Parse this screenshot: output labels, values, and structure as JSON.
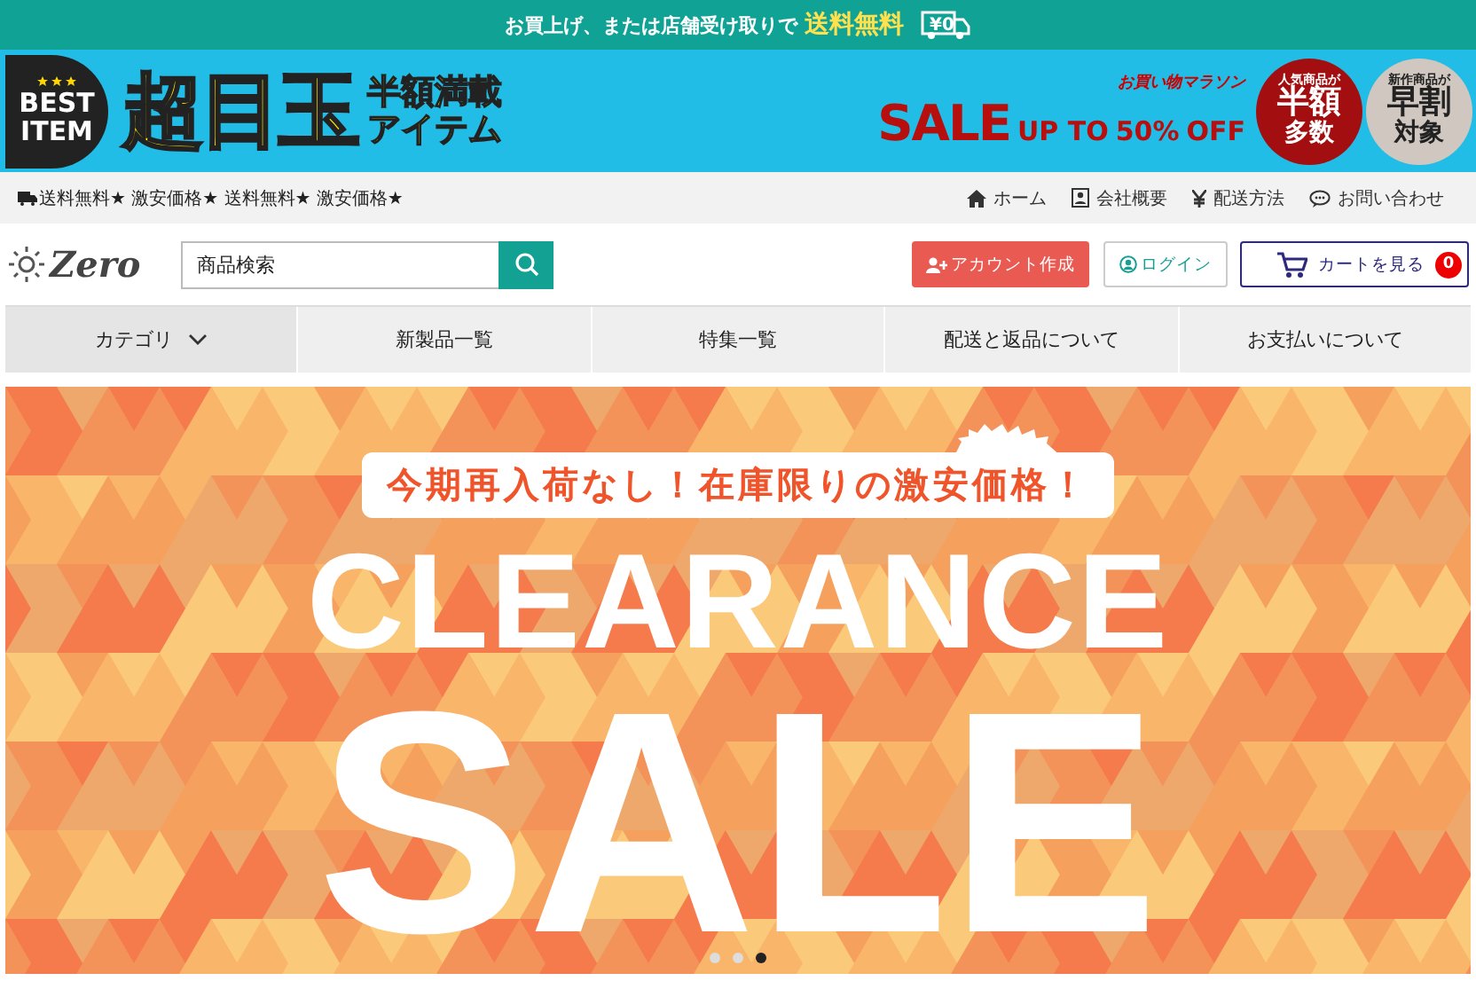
{
  "announcement": {
    "text": "お買上げ、または店舗受け取りで",
    "highlight": "送料無料",
    "badge": "¥0"
  },
  "promo_banner": {
    "badge_lines": [
      "BEST",
      "ITEM"
    ],
    "headline": "超目玉",
    "sub_lines": [
      "半額満載",
      "アイテム"
    ],
    "marathon": "お買い物マラソン",
    "sale": "SALE",
    "up_to": "UP TO",
    "percent": "50%",
    "off": "OFF",
    "circles": [
      {
        "small": "人気商品が",
        "big": "半額",
        "bottom": "多数",
        "color": "#a30f10"
      },
      {
        "small": "新作商品が",
        "big": "早割",
        "bottom": "対象",
        "color": "#cfc7c0"
      }
    ]
  },
  "ticker": "送料無料★ 激安価格★ 送料無料★ 激安価格★",
  "top_links": [
    {
      "kind": "home",
      "label": "ホーム"
    },
    {
      "kind": "company",
      "label": "会社概要"
    },
    {
      "kind": "shipping",
      "label": "配送方法"
    },
    {
      "kind": "contact",
      "label": "お問い合わせ"
    }
  ],
  "logo": "Zero",
  "search": {
    "placeholder": "商品検索"
  },
  "account_button": "アカウント作成",
  "login_button": "ログイン",
  "cart_button": {
    "label": "カートを見る",
    "count": "0"
  },
  "nav": [
    {
      "label": "カテゴリ",
      "kind": "dropdown"
    },
    {
      "label": "新製品一覧",
      "kind": "link"
    },
    {
      "label": "特集一覧",
      "kind": "link"
    },
    {
      "label": "配送と返品について",
      "kind": "link"
    },
    {
      "label": "お支払いについて",
      "kind": "link"
    }
  ],
  "hero": {
    "tagline": "今期再入荷なし！在庫限りの激安価格！",
    "title": "CLEARANCE",
    "subtitle": "SALE",
    "slides": [
      {
        "selected": false
      },
      {
        "selected": false
      },
      {
        "selected": true
      }
    ]
  }
}
